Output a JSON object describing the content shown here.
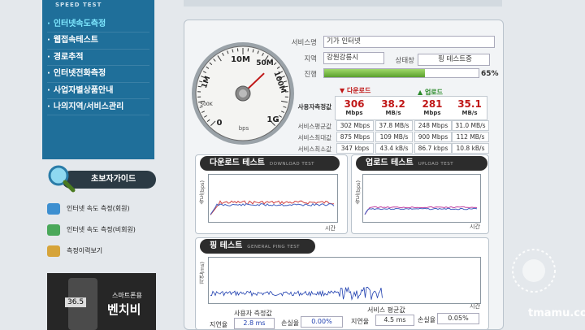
{
  "sidebar": {
    "brand": "SPEED TEST",
    "items": [
      {
        "label": "인터넷속도측정",
        "active": true
      },
      {
        "label": "웹접속테스트"
      },
      {
        "label": "경로추적"
      },
      {
        "label": "인터넷전화측정"
      },
      {
        "label": "사업자별상품안내"
      },
      {
        "label": "나의지역/서비스관리"
      }
    ],
    "guide_label": "초보자가이드",
    "links": [
      {
        "label": "인터넷 속도 측정(회원)"
      },
      {
        "label": "인터넷 속도 측정(비회원)"
      },
      {
        "label": "측정이력보기"
      }
    ],
    "promo": {
      "speed": "36.5",
      "line1": "스마트폰용",
      "line2": "벤치비"
    }
  },
  "gauge": {
    "labels": [
      "10M",
      "50M",
      "100M",
      "1G",
      "0",
      "1M",
      "500K",
      "bps"
    ],
    "needle_fraction": 0.32
  },
  "info": {
    "service_label": "서비스명",
    "service_value": "기가 인터넷",
    "region_label": "지역",
    "region_value": "강원강릉시",
    "status_label": "상태창",
    "status_value": "핑 테스트중",
    "progress_label": "진행",
    "progress_value": "65%",
    "progress_fraction": 0.65
  },
  "stats": {
    "download_label": "다운로드",
    "upload_label": "업로드",
    "rows": [
      {
        "label": "사용자측정값",
        "down_mbps": "306",
        "down_mbs": "38.2",
        "up_mbps": "281",
        "up_mbs": "35.1"
      },
      {
        "label": "서비스평균값",
        "cells": [
          "302 Mbps",
          "37.8 MB/s",
          "248 Mbps",
          "31.0 MB/s"
        ]
      },
      {
        "label": "서비스최대값",
        "cells": [
          "875 Mbps",
          "109 MB/s",
          "900 Mbps",
          "112 MB/s"
        ]
      },
      {
        "label": "서비스최소값",
        "cells": [
          "347 kbps",
          "43.4 kB/s",
          "86.7 kbps",
          "10.8 kB/s"
        ]
      }
    ],
    "unit_mbps": "Mbps",
    "unit_mbs": "MB/s"
  },
  "download_test": {
    "title": "다운로드 테스트",
    "subtitle": "DOWNLOAD TEST",
    "ylabel": "속도(bps)",
    "xlabel": "시간"
  },
  "upload_test": {
    "title": "업로드 테스트",
    "subtitle": "UPLOAD TEST",
    "ylabel": "속도(bps)",
    "xlabel": "시간"
  },
  "ping_test": {
    "title": "핑 테스트",
    "subtitle": "GENERAL PING TEST",
    "ylabel": "지연(ms)",
    "xlabel": "시간"
  },
  "bottom": {
    "user_label": "사용자 측정값",
    "service_label": "서비스 평균값",
    "latency_label": "지연율",
    "loss_label": "손실율",
    "user_latency": "2.8 ms",
    "user_loss": "0.00%",
    "service_latency": "4.5 ms",
    "service_loss": "0.05%"
  },
  "watermark": {
    "text": "tmamu.com"
  },
  "colors": {
    "sidebar": "#1f6f9a",
    "accent_red": "#c01818",
    "progress": "#5aa02c"
  }
}
